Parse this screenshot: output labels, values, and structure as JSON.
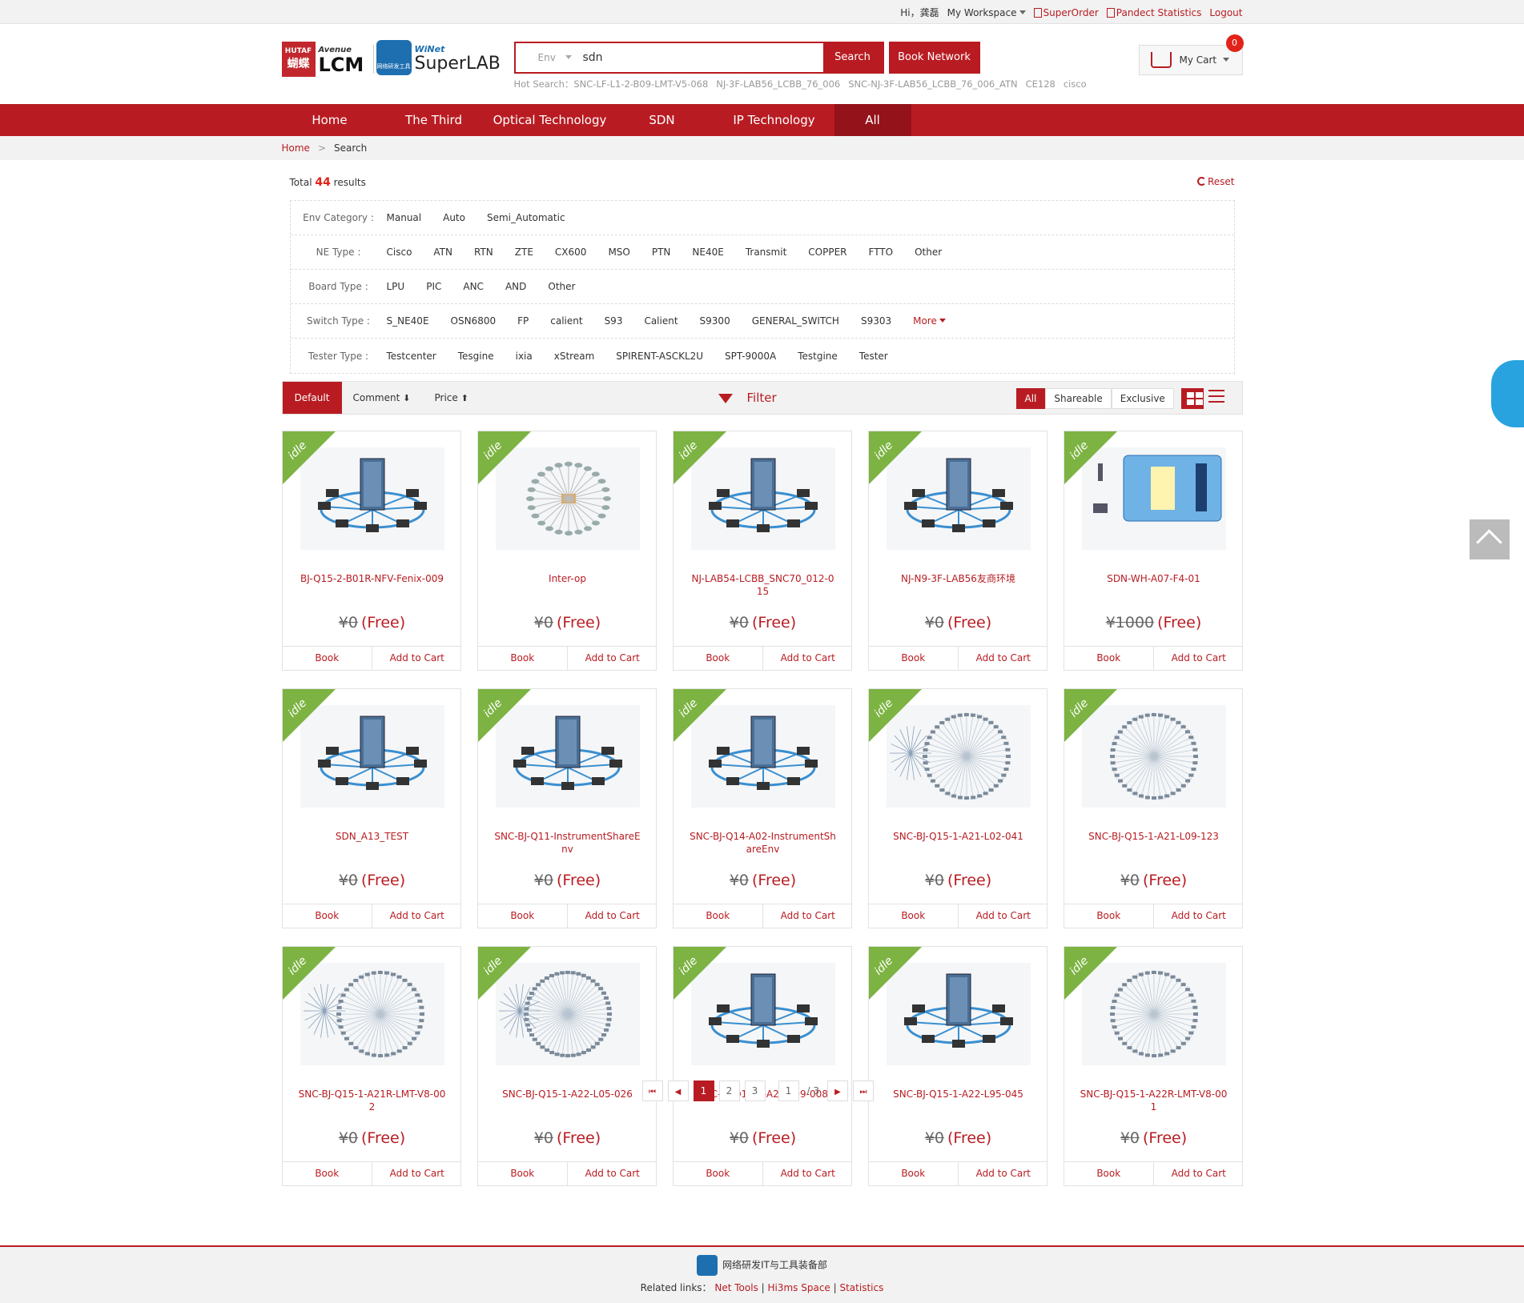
{
  "topbar": {
    "greeting": "Hi，龚磊",
    "workspace": "My Workspace",
    "superorder": "SuperOrder",
    "pandect": "Pandect Statistics",
    "logout": "Logout"
  },
  "logos": {
    "lcm_small": "HUTAF",
    "lcm_cn": "蝴蝶",
    "lcm_avenue": "Avenue",
    "lcm_name": "LCM",
    "wiznet_small": "WiNet",
    "wiznet_emblem": "网络研发工具",
    "wiznet_name": "SuperLAB"
  },
  "search": {
    "scope": "Env",
    "value": "sdn",
    "button": "Search",
    "book_network": "Book Network",
    "hot_label": "Hot Search：",
    "hot": [
      "SNC-LF-L1-2-B09-LMT-V5-068",
      "NJ-3F-LAB56_LCBB_76_006",
      "SNC-NJ-3F-LAB56_LCBB_76_006_ATN",
      "CE128",
      "cisco"
    ]
  },
  "cart": {
    "label": "My Cart",
    "count": "0"
  },
  "nav": [
    "Home",
    "The Third",
    "Optical Technology",
    "SDN",
    "IP Technology",
    "All"
  ],
  "breadcrumb": {
    "home": "Home",
    "sep": ">",
    "current": "Search"
  },
  "results": {
    "prefix": "Total",
    "count": "44",
    "suffix": "results",
    "reset": "Reset"
  },
  "filters": [
    {
      "label": "Env Category :",
      "options": [
        "Manual",
        "Auto",
        "Semi_Automatic"
      ]
    },
    {
      "label": "NE Type :",
      "options": [
        "Cisco",
        "ATN",
        "RTN",
        "ZTE",
        "CX600",
        "MSO",
        "PTN",
        "NE40E",
        "Transmit",
        "COPPER",
        "FTTO",
        "Other"
      ]
    },
    {
      "label": "Board Type :",
      "options": [
        "LPU",
        "PIC",
        "ANC",
        "AND",
        "Other"
      ]
    },
    {
      "label": "Switch Type :",
      "options": [
        "S_NE40E",
        "OSN6800",
        "FP",
        "calient",
        "S93",
        "Calient",
        "S9300",
        "GENERAL_SWITCH",
        "S9303"
      ],
      "more": "More"
    },
    {
      "label": "Tester Type :",
      "options": [
        "Testcenter",
        "Tesgine",
        "ixia",
        "xStream",
        "SPIRENT-ASCKL2U",
        "SPT-9000A",
        "Testgine",
        "Tester"
      ]
    }
  ],
  "sortbar": {
    "default": "Default",
    "comment": "Comment",
    "price": "Price",
    "filter": "Filter",
    "share_all": "All",
    "shareable": "Shareable",
    "exclusive": "Exclusive"
  },
  "card_actions": {
    "book": "Book",
    "add": "Add to Cart",
    "status": "idle"
  },
  "products": [
    {
      "name": "BJ-Q15-2-B01R-NFV-Fenix-009",
      "price": "¥0",
      "note": "(Free)",
      "img": "server"
    },
    {
      "name": "Inter-op",
      "price": "¥0",
      "note": "(Free)",
      "img": "interop"
    },
    {
      "name": "NJ-LAB54-LCBB_SNC70_012-015",
      "price": "¥0",
      "note": "(Free)",
      "img": "server"
    },
    {
      "name": "NJ-N9-3F-LAB56友商环境",
      "price": "¥0",
      "note": "(Free)",
      "img": "server"
    },
    {
      "name": "SDN-WH-A07-F4-01",
      "price": "¥1000",
      "note": "(Free)",
      "img": "cloud"
    },
    {
      "name": "SDN_A13_TEST",
      "price": "¥0",
      "note": "(Free)",
      "img": "server"
    },
    {
      "name": "SNC-BJ-Q11-InstrumentShareEnv",
      "price": "¥0",
      "note": "(Free)",
      "img": "server"
    },
    {
      "name": "SNC-BJ-Q14-A02-InstrumentShareEnv",
      "price": "¥0",
      "note": "(Free)",
      "img": "server"
    },
    {
      "name": "SNC-BJ-Q15-1-A21-L02-041",
      "price": "¥0",
      "note": "(Free)",
      "img": "topo2"
    },
    {
      "name": "SNC-BJ-Q15-1-A21-L09-123",
      "price": "¥0",
      "note": "(Free)",
      "img": "topo"
    },
    {
      "name": "SNC-BJ-Q15-1-A21R-LMT-V8-002",
      "price": "¥0",
      "note": "(Free)",
      "img": "topo2"
    },
    {
      "name": "SNC-BJ-Q15-1-A22-L05-026",
      "price": "¥0",
      "note": "(Free)",
      "img": "topo3"
    },
    {
      "name": "SNC-BJ-Q15-1-A22-L09-008",
      "price": "¥0",
      "note": "(Free)",
      "img": "server"
    },
    {
      "name": "SNC-BJ-Q15-1-A22-L95-045",
      "price": "¥0",
      "note": "(Free)",
      "img": "server"
    },
    {
      "name": "SNC-BJ-Q15-1-A22R-LMT-V8-001",
      "price": "¥0",
      "note": "(Free)",
      "img": "topo"
    }
  ],
  "pager": {
    "pages": [
      "1",
      "2",
      "3"
    ],
    "current": "1",
    "input": "1",
    "total": "/ 3"
  },
  "footer": {
    "dept": "网络研发IT与工具装备部",
    "links_label": "Related links：",
    "links": [
      "Net Tools",
      "Hi3ms Space",
      "Statistics"
    ]
  },
  "colors": {
    "brand": "#b81c22",
    "idle": "#7cb342"
  }
}
